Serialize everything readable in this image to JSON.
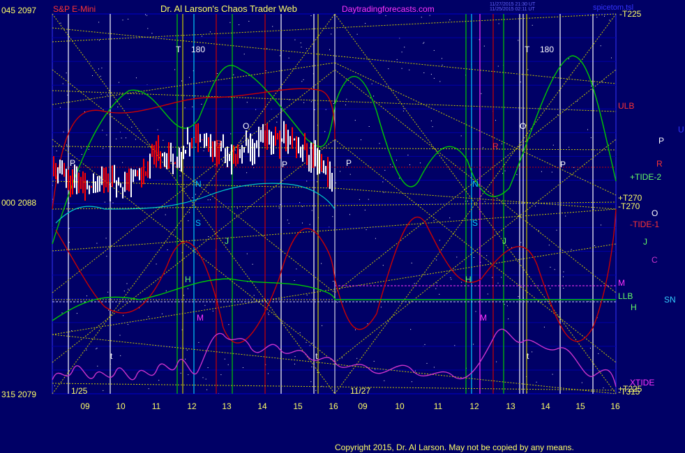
{
  "header": {
    "left_top": "045  2097",
    "left_mid": "000  2088",
    "left_bot": "315  2079",
    "instrument": "S&P E-Mini",
    "title": "Dr. Al Larson's Chaos Trader Web",
    "site": "Daytradingforecasts.com",
    "timestamp_1": "11/27/2015 21:30 UT",
    "timestamp_2": "11/25/2015 02:11 UT",
    "tag_right": "spicetom.tsl",
    "copyright": "Copyright 2015, Dr. Al Larson. May not be copied by any means."
  },
  "chart_data": {
    "type": "line",
    "title": "S&P E-Mini",
    "ylim": [
      2079,
      2097
    ],
    "y_ticks": [
      2097,
      2088,
      2079
    ],
    "x_tick_labels": [
      "09",
      "10",
      "11",
      "12",
      "13",
      "14",
      "15",
      "16",
      "09",
      "10",
      "11",
      "12",
      "13",
      "14",
      "15",
      "16"
    ],
    "date_labels": [
      "1/25",
      "11/27"
    ],
    "right_labels": [
      "-T225",
      "ULB",
      "+TIDE-2",
      "+T270",
      "-T270",
      "-TIDE-1",
      "M",
      "LLB",
      "XTIDE",
      "+T225",
      "-T315"
    ],
    "far_right_labels": [
      "U",
      "P",
      "R",
      "O",
      "J",
      "C",
      "H",
      "SN"
    ],
    "chart_letters": [
      "P",
      "O",
      "R",
      "P",
      "N",
      "S",
      "J",
      "H",
      "M",
      "t",
      "T",
      "180",
      "P",
      "O",
      "R",
      "P",
      "N",
      "S",
      "J",
      "H",
      "M",
      "t",
      "T",
      "180",
      "t"
    ],
    "colors": {
      "background": "#000066",
      "price_bar": "#ffffff",
      "price_down": "#ff0000",
      "green_line": "#00cc00",
      "red_line": "#cc0000",
      "magenta_line": "#cc33cc",
      "gridline": "#0000cc",
      "yellow_dotted": "#cccc00"
    }
  }
}
